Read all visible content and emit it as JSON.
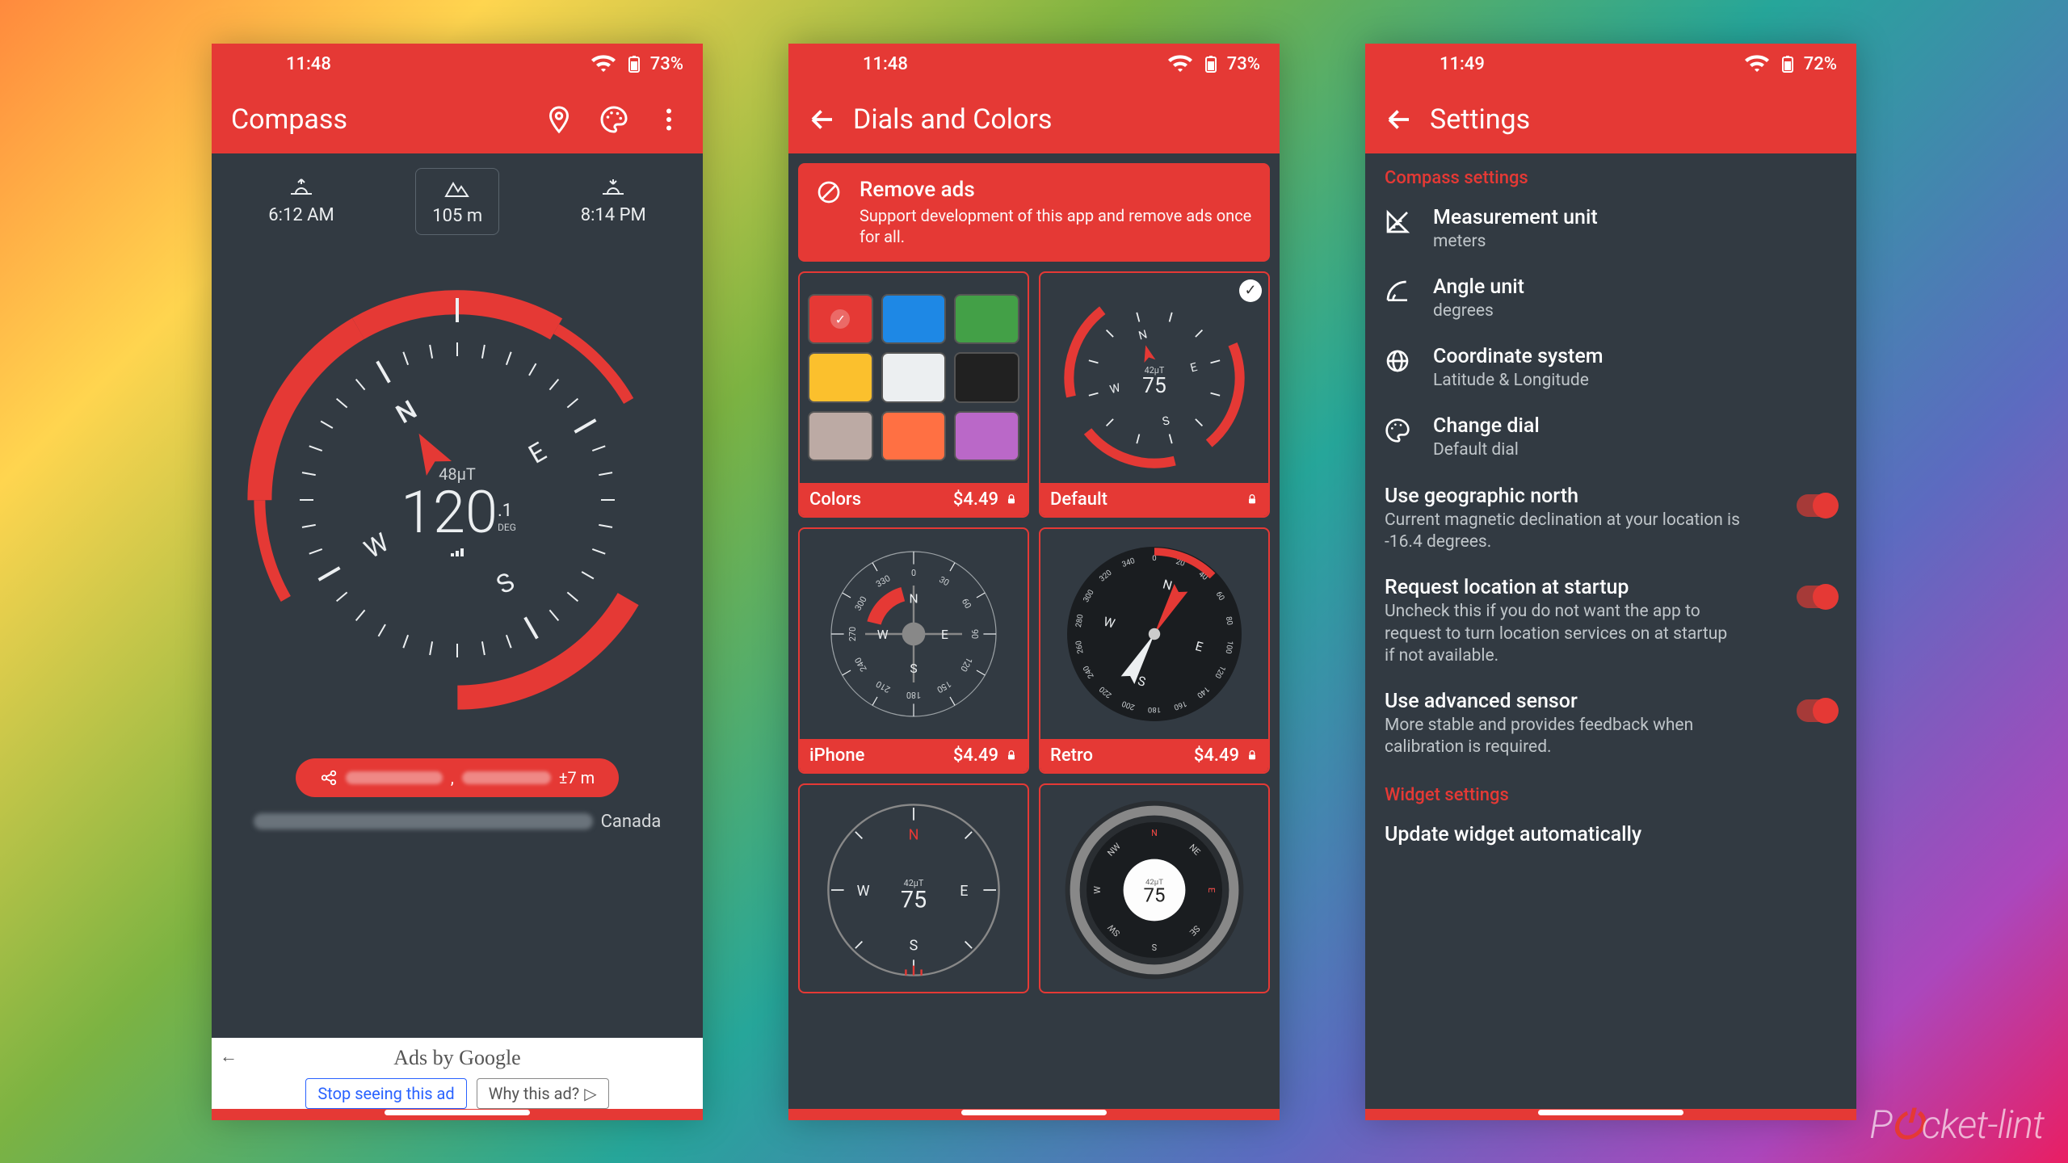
{
  "watermark": "Pocket-lint",
  "phone1": {
    "status": {
      "time": "11:48",
      "battery": "73%"
    },
    "appbar": {
      "title": "Compass"
    },
    "sun": {
      "sunrise": "6:12 AM",
      "altitude": "105 m",
      "sunset": "8:14 PM"
    },
    "compass": {
      "field": "48µT",
      "heading": "120",
      "decimal": ".1",
      "unit": "DEG",
      "cardinals": {
        "n": "N",
        "e": "E",
        "s": "S",
        "w": "W"
      }
    },
    "location": {
      "accuracy": "±7 m",
      "country": "Canada"
    },
    "ads": {
      "by": "Ads by Google",
      "stop": "Stop seeing this ad",
      "why": "Why this ad?"
    }
  },
  "phone2": {
    "status": {
      "time": "11:48",
      "battery": "73%"
    },
    "appbar": {
      "title": "Dials and Colors"
    },
    "remove": {
      "title": "Remove ads",
      "desc": "Support development of this app and remove ads once for all."
    },
    "cards": {
      "colors": {
        "label": "Colors",
        "price": "$4.49"
      },
      "default": {
        "label": "Default",
        "heading": "75",
        "field": "42µT"
      },
      "iphone": {
        "label": "iPhone",
        "price": "$4.49"
      },
      "retro": {
        "label": "Retro",
        "price": "$4.49"
      },
      "bottom_left_heading": "75",
      "bottom_left_field": "42µT",
      "bottom_right_heading": "75",
      "bottom_right_field": "42µT"
    },
    "colors": [
      "#e53935",
      "#1e88e5",
      "#43a047",
      "#fbc02d",
      "#eceff1",
      "#212121",
      "#bcaaa4",
      "#ff7043",
      "#ba68c8"
    ]
  },
  "phone3": {
    "status": {
      "time": "11:49",
      "battery": "72%"
    },
    "appbar": {
      "title": "Settings"
    },
    "sections": {
      "compass": "Compass settings",
      "widget": "Widget settings"
    },
    "items": {
      "unit": {
        "title": "Measurement unit",
        "value": "meters"
      },
      "angle": {
        "title": "Angle unit",
        "value": "degrees"
      },
      "coord": {
        "title": "Coordinate system",
        "value": "Latitude & Longitude"
      },
      "dial": {
        "title": "Change dial",
        "value": "Default dial"
      },
      "geo": {
        "title": "Use geographic north",
        "desc": "Current magnetic declination at your location is -16.4 degrees."
      },
      "loc": {
        "title": "Request location at startup",
        "desc": "Uncheck this if you do not want the app to request to turn location services on at startup if not available."
      },
      "sensor": {
        "title": "Use advanced sensor",
        "desc": "More stable and provides feedback when calibration is required."
      },
      "widget": {
        "title": "Update widget automatically"
      }
    }
  }
}
